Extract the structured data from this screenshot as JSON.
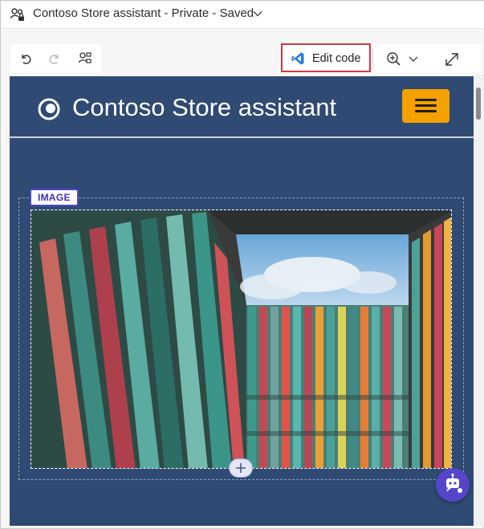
{
  "window": {
    "title": "Contoso Store assistant - Private - Saved"
  },
  "toolbar": {
    "undo_icon": "undo-icon",
    "redo_icon": "redo-icon",
    "tree_view_icon": "tree-view-icon",
    "edit_code_label": "Edit code",
    "zoom_icon": "zoom-in-icon",
    "expand_icon": "expand-icon"
  },
  "app": {
    "title": "Contoso Store assistant",
    "header_color": "#2f4a73",
    "menu_button_color": "#f5a100"
  },
  "image_block": {
    "tag_label": "IMAGE",
    "tag_color": "#4f46c9"
  },
  "colors": {
    "accent": "#5445c9",
    "highlight_border": "#d9343b"
  }
}
